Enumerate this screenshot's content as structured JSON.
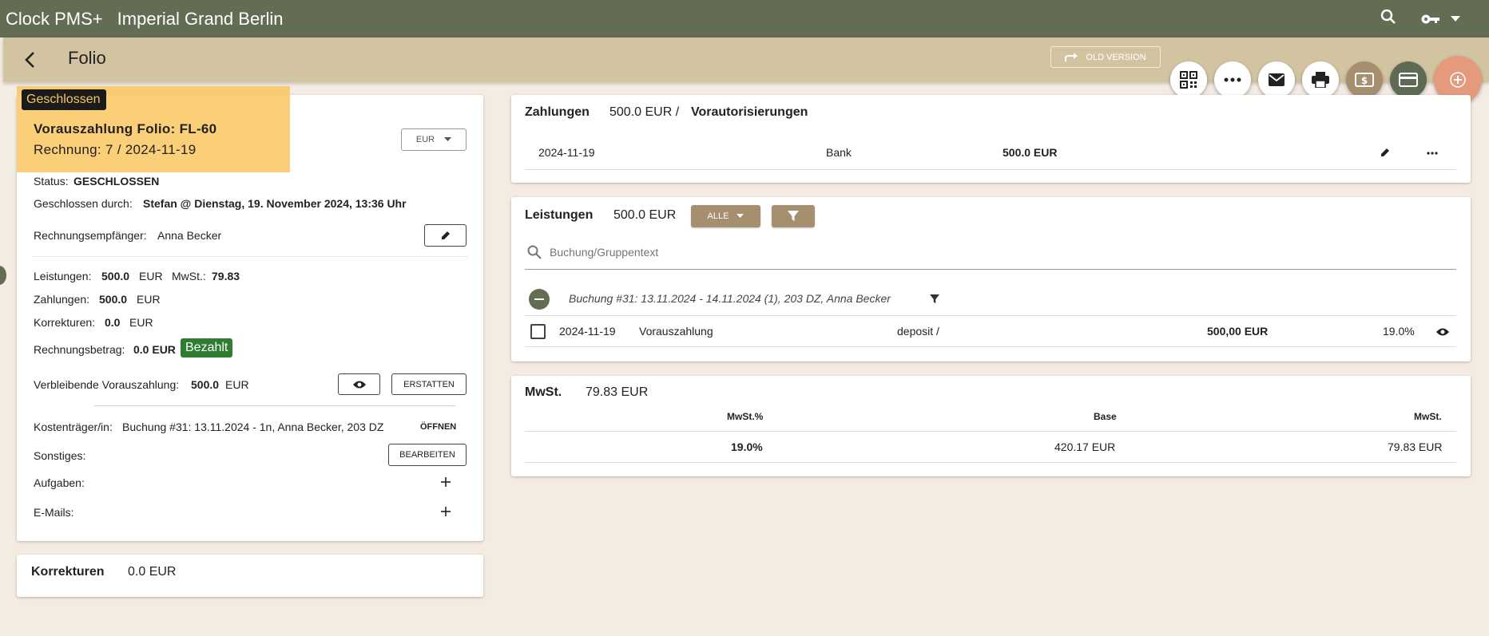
{
  "topbar": {
    "app": "Clock PMS+",
    "hotel": "Imperial Grand Berlin",
    "icons": [
      "search-icon",
      "key-icon",
      "caret-down-icon"
    ]
  },
  "subbar": {
    "title": "Folio",
    "old_version": "OLD VERSION"
  },
  "fabs": [
    "qr-icon",
    "more-icon",
    "mail-icon",
    "print-icon",
    "cash-icon",
    "card-icon",
    "add-icon"
  ],
  "folio": {
    "state_chip": "Geschlossen",
    "title": "Vorauszahlung Folio: FL-60",
    "invoice": "Rechnung: 7 / 2024-11-19",
    "currency": "EUR",
    "status_label": "Status:",
    "status_value": "GESCHLOSSEN",
    "closed_by_label": "Geschlossen durch:",
    "closed_by_value": "Stefan @ Dienstag, 19. November 2024, 13:36 Uhr",
    "recipient_label": "Rechnungsempfänger:",
    "recipient_value": "Anna Becker",
    "services_label": "Leistungen:",
    "services_value": "500.0",
    "services_cur": "EUR",
    "vat_label": "MwSt.:",
    "vat_value": "79.83",
    "payments_label": "Zahlungen:",
    "payments_value": "500.0",
    "payments_cur": "EUR",
    "corrections_label": "Korrekturen:",
    "corrections_value": "0.0",
    "corrections_cur": "EUR",
    "amount_label": "Rechnungsbetrag:",
    "amount_value": "0.0 EUR",
    "paid_badge": "Bezahlt",
    "remaining_label": "Verbleibende Vorauszahlung:",
    "remaining_value": "500.0",
    "remaining_cur": "EUR",
    "create_btn": "ERSTATTEN",
    "payer_label": "Kostenträger/in:",
    "payer_value": "Buchung #31: 13.11.2024 - 1n, Anna Becker, 203 DZ",
    "open_btn": "ÖFFNEN",
    "misc_label": "Sonstiges:",
    "edit_btn": "BEARBEITEN",
    "tasks_label": "Aufgaben:",
    "emails_label": "E-Mails:"
  },
  "corrections_card": {
    "title": "Korrekturen",
    "value": "0.0 EUR"
  },
  "payments": {
    "title": "Zahlungen",
    "amount": "500.0 EUR /",
    "preauth": "Vorautorisierungen",
    "rows": [
      {
        "date": "2024-11-19",
        "method": "Bank",
        "amount": "500.0 EUR"
      }
    ]
  },
  "services": {
    "title": "Leistungen",
    "amount": "500.0 EUR",
    "filter_all": "ALLE",
    "search_placeholder": "Buchung/Gruppentext",
    "booking_group": "Buchung #31: 13.11.2024 - 14.11.2024 (1), 203 DZ, Anna Becker",
    "rows": [
      {
        "date": "2024-11-19",
        "name": "Vorauszahlung",
        "type": "deposit /",
        "amount": "500,00 EUR",
        "vat": "19.0%"
      }
    ]
  },
  "vat": {
    "title": "MwSt.",
    "amount": "79.83 EUR",
    "headers": [
      "MwSt.%",
      "Base",
      "MwSt."
    ],
    "rows": [
      {
        "rate": "19.0%",
        "base": "420.17 EUR",
        "vat": "79.83 EUR"
      }
    ]
  },
  "colors": {
    "topbar": "#636d54",
    "subbar": "#d3c4a1",
    "accent_brown": "#a68f6f",
    "paid_green": "#2e7d32",
    "highlight": "#fac35a"
  }
}
